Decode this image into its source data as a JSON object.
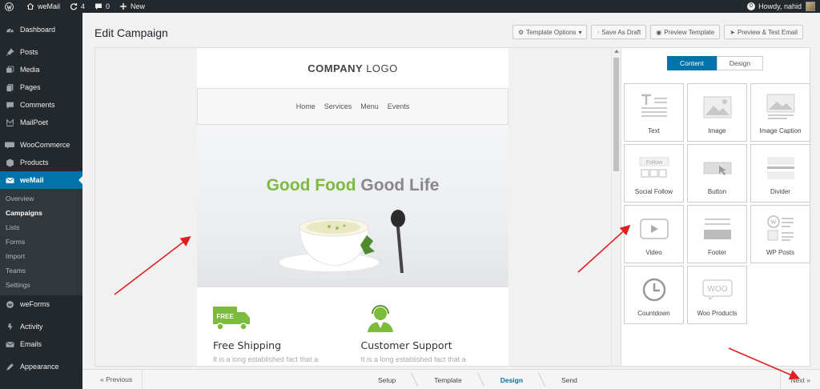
{
  "adminbar": {
    "site_name": "weMail",
    "updates_count": "4",
    "comments_count": "0",
    "new_label": "New",
    "notif_count": "0",
    "greeting": "Howdy, nahid"
  },
  "sidebar": {
    "items": [
      {
        "label": "Dashboard",
        "icon": "dashboard-icon"
      },
      {
        "label": "Posts",
        "icon": "pin-icon"
      },
      {
        "label": "Media",
        "icon": "media-icon"
      },
      {
        "label": "Pages",
        "icon": "pages-icon"
      },
      {
        "label": "Comments",
        "icon": "comments-icon"
      },
      {
        "label": "MailPoet",
        "icon": "mailpoet-icon"
      },
      {
        "label": "WooCommerce",
        "icon": "woo-icon"
      },
      {
        "label": "Products",
        "icon": "products-icon"
      },
      {
        "label": "weMail",
        "icon": "mail-icon"
      },
      {
        "label": "weForms",
        "icon": "weforms-icon"
      },
      {
        "label": "Activity",
        "icon": "activity-icon"
      },
      {
        "label": "Emails",
        "icon": "email-icon"
      },
      {
        "label": "Appearance",
        "icon": "appearance-icon"
      }
    ],
    "submenu": [
      "Overview",
      "Campaigns",
      "Lists",
      "Forms",
      "Import",
      "Teams",
      "Settings"
    ]
  },
  "page": {
    "title": "Edit Campaign",
    "buttons": {
      "template_options": "Template Options",
      "save_draft": "Save As Draft",
      "preview_template": "Preview Template",
      "preview_test": "Preview & Test Email"
    }
  },
  "email": {
    "logo_bold": "COMPANY",
    "logo_rest": "LOGO",
    "nav": [
      "Home",
      "Services",
      "Menu",
      "Events"
    ],
    "hero_green": "Good Food",
    "hero_gray": "Good Life",
    "features": [
      {
        "badge": "FREE",
        "title": "Free Shipping",
        "desc": "It is a long established fact that a"
      },
      {
        "title": "Customer Support",
        "desc": "It is a long established fact that a"
      }
    ]
  },
  "panel": {
    "tabs": [
      "Content",
      "Design"
    ],
    "active_tab": "Content",
    "blocks": [
      "Text",
      "Image",
      "Image Caption",
      "Social Follow",
      "Button",
      "Divider",
      "Video",
      "Footer",
      "WP Posts",
      "Countdown",
      "Woo Products"
    ],
    "social_follow_text": "Follow"
  },
  "wizard": {
    "previous": "« Previous",
    "steps": [
      "Setup",
      "Template",
      "Design",
      "Send"
    ],
    "current_step": "Design",
    "next": "Next »"
  },
  "colors": {
    "accent": "#0073aa",
    "green": "#7cbb3b",
    "sidebar_bg": "#23282d",
    "arrow_red": "#e02020"
  }
}
